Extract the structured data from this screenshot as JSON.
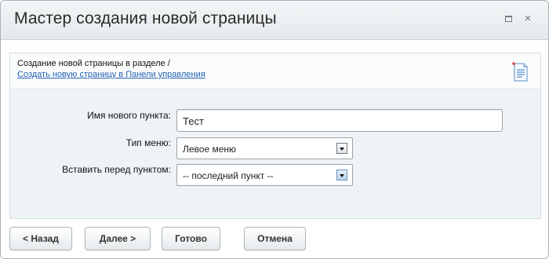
{
  "dialog": {
    "title": "Мастер создания новой страницы",
    "maximize_icon": "maximize-icon",
    "close_icon": "close-icon",
    "close_glyph": "×"
  },
  "info": {
    "text": "Создание новой страницы в разделе /",
    "link": "Создать новую страницу в Панели управления",
    "icon": "new-page-icon"
  },
  "form": {
    "item_name_label": "Имя нового пункта:",
    "item_name_value": "Тест",
    "menu_type_label": "Тип меню:",
    "menu_type_value": "Левое меню",
    "insert_before_label": "Вставить перед пунктом:",
    "insert_before_value": "-- последний пункт --"
  },
  "buttons": {
    "back": "< Назад",
    "next": "Далее >",
    "done": "Готово",
    "cancel": "Отмена"
  },
  "colors": {
    "link": "#2462b4",
    "content_bg": "#eef3f5",
    "titlebar": "#e4e9eb"
  }
}
